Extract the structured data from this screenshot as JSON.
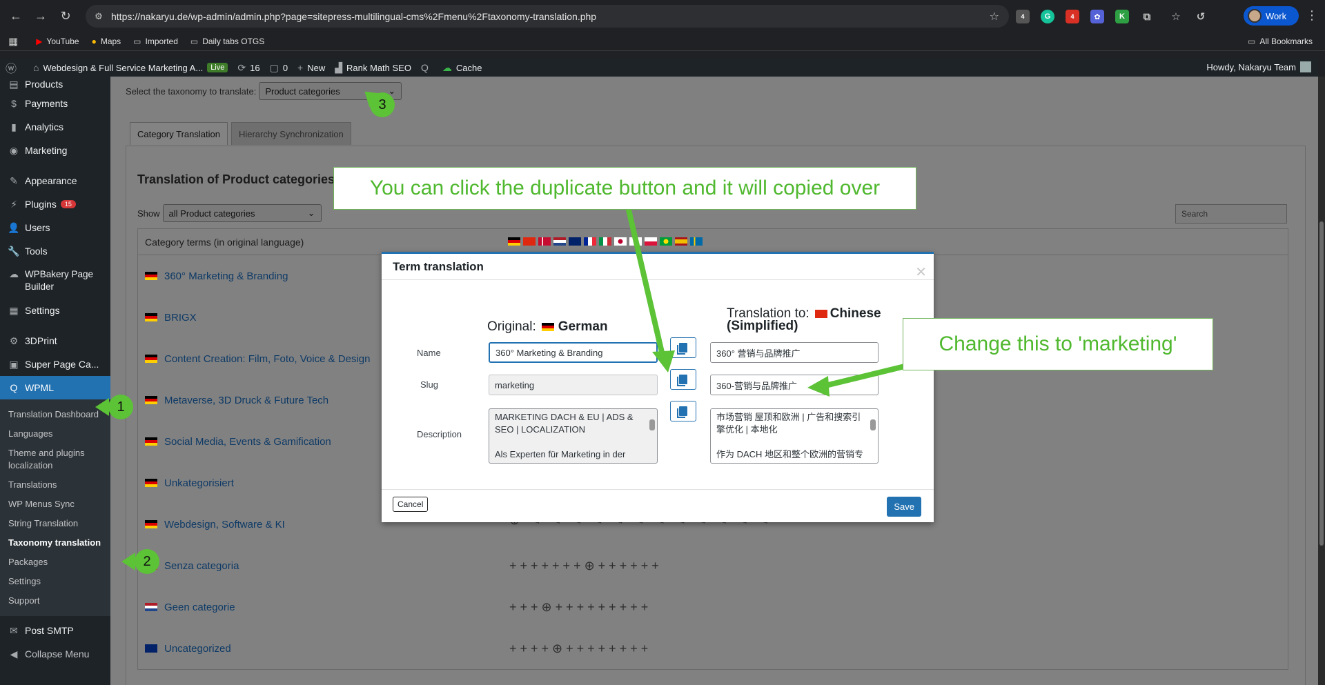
{
  "browser": {
    "url": "https://nakaryu.de/wp-admin/admin.php?page=sitepress-multilingual-cms%2Fmenu%2Ftaxonomy-translation.php",
    "profile_label": "Work",
    "bookmarks": [
      "YouTube",
      "Maps",
      "Imported",
      "Daily tabs OTGS"
    ],
    "all_bookmarks": "All Bookmarks",
    "extension_badges": [
      "4",
      "4"
    ]
  },
  "adminbar": {
    "site_name": "Webdesign & Full Service Marketing A...",
    "live": "Live",
    "updates": "16",
    "comments": "0",
    "new": "New",
    "rank_math": "Rank Math SEO",
    "cache": "Cache",
    "howdy": "Howdy, Nakaryu Team"
  },
  "sidebar": {
    "items": [
      {
        "label": "Products",
        "icon": "products-icon"
      },
      {
        "label": "Payments",
        "icon": "payments-icon"
      },
      {
        "label": "Analytics",
        "icon": "analytics-icon"
      },
      {
        "label": "Marketing",
        "icon": "marketing-icon"
      },
      {
        "label": "Appearance",
        "icon": "appearance-icon"
      },
      {
        "label": "Plugins",
        "icon": "plugins-icon",
        "count": "15"
      },
      {
        "label": "Users",
        "icon": "users-icon"
      },
      {
        "label": "Tools",
        "icon": "tools-icon"
      },
      {
        "label": "WPBakery Page Builder",
        "icon": "wpbakery-icon"
      },
      {
        "label": "Settings",
        "icon": "settings-icon"
      },
      {
        "label": "3DPrint",
        "icon": "3dprint-icon"
      },
      {
        "label": "Super Page Ca...",
        "icon": "super-page-cache-icon"
      },
      {
        "label": "WPML",
        "icon": "wpml-icon"
      }
    ],
    "wpml_submenu": [
      "Translation Dashboard",
      "Languages",
      "Theme and plugins localization",
      "Translations",
      "WP Menus Sync",
      "String Translation",
      "Taxonomy translation",
      "Packages",
      "Settings",
      "Support"
    ],
    "bottom_items": [
      "Post SMTP",
      "Collapse Menu"
    ]
  },
  "page": {
    "taxonomy_prompt": "Select the taxonomy to translate:",
    "taxonomy_selected": "Product categories",
    "tabs": [
      "Category Translation",
      "Hierarchy Synchronization"
    ],
    "title": "Translation of Product categories",
    "show_label": "Show",
    "show_selected": "all Product categories",
    "search_placeholder": "Search",
    "column_header": "Category terms (in original language)",
    "terms": [
      {
        "name": "360° Marketing & Branding",
        "flag": "de"
      },
      {
        "name": "BRIGX",
        "flag": "de"
      },
      {
        "name": "Content Creation: Film, Foto, Voice & Design",
        "flag": "de"
      },
      {
        "name": "Metaverse, 3D Druck & Future Tech",
        "flag": "de"
      },
      {
        "name": "Social Media, Events & Gamification",
        "flag": "de"
      },
      {
        "name": "Unkategorisiert",
        "flag": "de"
      },
      {
        "name": "Webdesign, Software & KI",
        "flag": "de"
      },
      {
        "name": "Senza categoria",
        "flag": "it"
      },
      {
        "name": "Geen categorie",
        "flag": "nl"
      },
      {
        "name": "Uncategorized",
        "flag": "gb"
      }
    ]
  },
  "modal": {
    "title": "Term translation",
    "original_label": "Original:",
    "original_lang": "German",
    "translation_label": "Translation to:",
    "translation_lang_line1": "Chinese",
    "translation_lang_line2": "(Simplified)",
    "labels": {
      "name": "Name",
      "slug": "Slug",
      "description": "Description"
    },
    "original": {
      "name": "360° Marketing & Branding",
      "slug": "marketing",
      "description_lines": [
        "MARKETING DACH & EU | ADS &",
        "SEO | LOCALIZATION",
        "",
        "Als Experten für Marketing in der"
      ]
    },
    "translation": {
      "name": "360° 营销与品牌推广",
      "slug": "360-营销与品牌推广",
      "description_lines": [
        "市场营销 屋顶和欧洲 | 广告和搜索引",
        "擎优化 | 本地化",
        "",
        "作为 DACH 地区和整个欧洲的营销专"
      ]
    },
    "cancel": "Cancel",
    "save": "Save"
  },
  "annotations": {
    "callout_duplicate": "You can click the duplicate button and it will copied over",
    "callout_change": "Change this to 'marketing'",
    "step1": "1",
    "step2": "2",
    "step3": "3"
  }
}
